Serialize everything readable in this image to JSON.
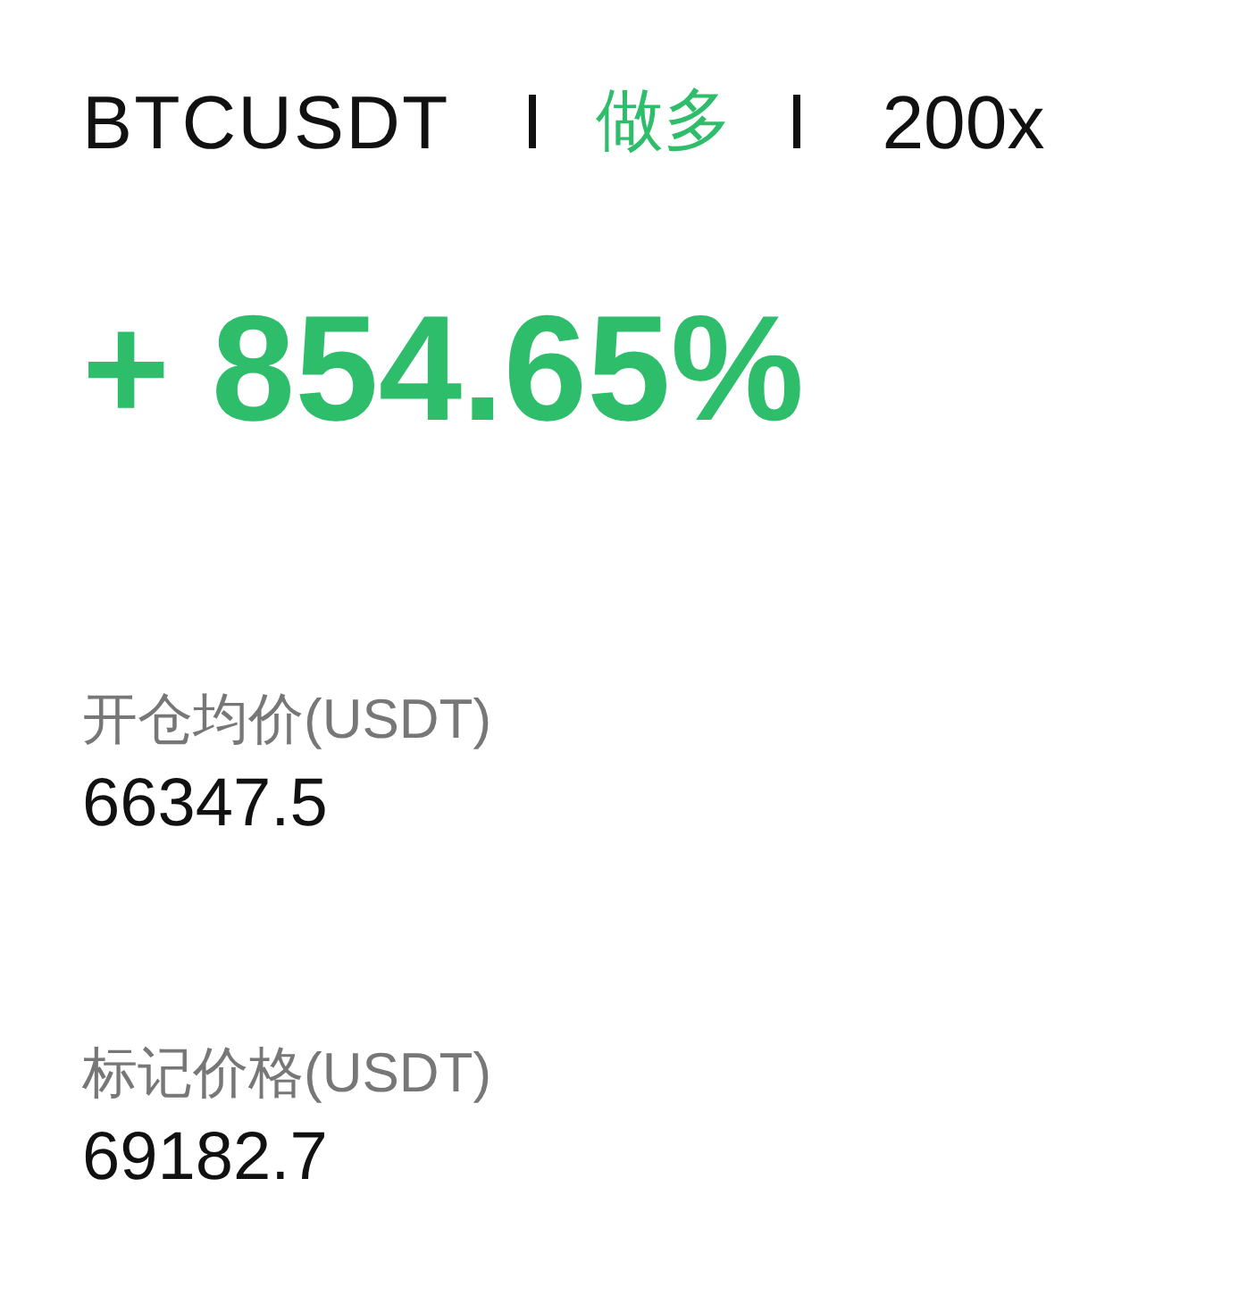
{
  "position": {
    "symbol": "BTCUSDT",
    "side": {
      "text": "做多",
      "kind": "long"
    },
    "leverage": "200x"
  },
  "pnl": {
    "text": "+ 854.65%",
    "kind": "profit"
  },
  "fields": [
    {
      "label": "开仓均价(USDT)",
      "value": "66347.5"
    },
    {
      "label": "标记价格(USDT)",
      "value": "69182.7"
    }
  ]
}
